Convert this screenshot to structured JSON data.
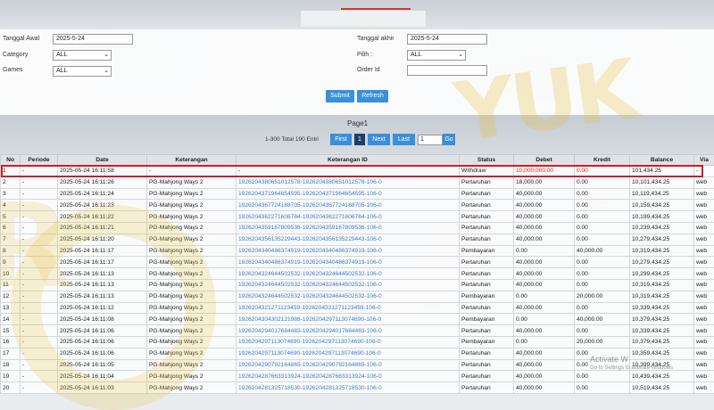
{
  "filters": {
    "tanggal_awal_label": "Tanggal Awal",
    "tanggal_awal_value": "2025-5-24",
    "tanggal_akhir_label": "Tanggal akhir",
    "tanggal_akhir_value": "2025-5-24",
    "category_label": "Category",
    "category_value": "ALL",
    "pilih_label": "Pilih :",
    "pilih_value": "ALL",
    "games_label": "Games",
    "games_value": "ALL",
    "order_id_label": "Order Id",
    "order_id_value": "",
    "submit_label": "Submit",
    "refresh_label": "Refresh"
  },
  "pager": {
    "title": "Page1",
    "total": "1-300 Total 190 Entri",
    "first": "First",
    "current": "1",
    "next": "Next",
    "last": "Last",
    "page_input": "1",
    "go": "Go"
  },
  "table": {
    "headers": [
      "No",
      "Periode",
      "Date",
      "Keterangan",
      "Keterangan ID",
      "Status",
      "Debet",
      "Kredit",
      "Balance",
      "Via"
    ],
    "rows": [
      [
        "1",
        "-",
        "2025-05-24 16:11:58",
        "-",
        "-",
        "Withdraw",
        "10,000,000.00",
        "0.00",
        "101,434.25",
        "-"
      ],
      [
        "2",
        "-",
        "2025-05-24 16:11:26",
        "PG-Mahjong Ways 2",
        "1926204380651012578-1926204380651012578-106-0",
        "Pertaruhan",
        "18,000.00",
        "0.00",
        "10,101,434.25",
        "web"
      ],
      [
        "3",
        "-",
        "2025-05-24 16:11:24",
        "PG-Mahjong Ways 2",
        "1926204371964654595-1926204371964654595-106-0",
        "Pertaruhan",
        "40,000.00",
        "0.00",
        "10,119,434.25",
        "web"
      ],
      [
        "4",
        "-",
        "2025-05-24 16:11:23",
        "PG-Mahjong Ways 2",
        "1926204367724168705-1926204367724168705-106-0",
        "Pertaruhan",
        "40,000.00",
        "0.00",
        "10,159,434.25",
        "web"
      ],
      [
        "5",
        "-",
        "2025-05-24 16:11:22",
        "PG-Mahjong Ways 2",
        "1926204362271606784-1926204362271606784-106-0",
        "Pertaruhan",
        "40,000.00",
        "0.00",
        "10,199,434.25",
        "web"
      ],
      [
        "6",
        "-",
        "2025-05-24 16:11:21",
        "PG-Mahjong Ways 2",
        "1926204359167809536-1926204359167809536-106-0",
        "Pertaruhan",
        "40,000.00",
        "0.00",
        "10,239,434.25",
        "web"
      ],
      [
        "7",
        "-",
        "2025-05-24 16:11:20",
        "PG-Mahjong Ways 2",
        "1926204356135229443-1926204356135229443-106-0",
        "Pertaruhan",
        "40,000.00",
        "0.00",
        "10,279,434.25",
        "web"
      ],
      [
        "8",
        "-",
        "2025-05-24 16:11:17",
        "PG-Mahjong Ways 2",
        "1926204340486374919-1926204340486374919-106-0",
        "Pembayaran",
        "0.00",
        "40,000.00",
        "10,319,434.25",
        "web"
      ],
      [
        "9",
        "-",
        "2025-05-24 16:11:17",
        "PG-Mahjong Ways 2",
        "1926204340486374919-1926204340486374919-106-0",
        "Pertaruhan",
        "40,000.00",
        "0.00",
        "10,279,434.25",
        "web"
      ],
      [
        "10",
        "-",
        "2025-05-24 16:11:13",
        "PG-Mahjong Ways 2",
        "1926204324644502532-1926204324644502532-106-0",
        "Pertaruhan",
        "40,000.00",
        "0.00",
        "10,299,434.25",
        "web"
      ],
      [
        "11",
        "-",
        "2025-05-24 16:11:13",
        "PG-Mahjong Ways 2",
        "1926204324644502532-1926204324644502532-106-0",
        "Pertaruhan",
        "40,000.00",
        "0.00",
        "10,319,434.25",
        "web"
      ],
      [
        "12",
        "-",
        "2025-05-24 16:11:13",
        "PG-Mahjong Ways 2",
        "1926204324644502532-1926204324644502532-106-0",
        "Pembayaran",
        "0.00",
        "20,000.00",
        "10,319,434.25",
        "web"
      ],
      [
        "13",
        "-",
        "2025-05-24 16:11:12",
        "PG-Mahjong Ways 2",
        "1926204321271123459-1926204321271123459-106-0",
        "Pertaruhan",
        "40,000.00",
        "0.00",
        "10,339,434.25",
        "web"
      ],
      [
        "14",
        "-",
        "2025-05-24 16:11:08",
        "PG-Mahjong Ways 2",
        "1926204304302121988-1926204297113074690-106-0",
        "Pembayaran",
        "0.00",
        "40,000.00",
        "10,379,434.25",
        "web"
      ],
      [
        "15",
        "-",
        "2025-05-24 16:11:06",
        "PG-Mahjong Ways 2",
        "1926204294017684483-1926204294017684483-106-0",
        "Pertaruhan",
        "40,000.00",
        "0.00",
        "10,339,434.25",
        "web"
      ],
      [
        "16",
        "-",
        "2025-05-24 16:11:06",
        "PG-Mahjong Ways 2",
        "1926204297113074690-1926204297113074690-106-0",
        "Pembayaran",
        "0.00",
        "20,000.00",
        "10,379,434.25",
        "web"
      ],
      [
        "17",
        "-",
        "2025-05-24 16:11:06",
        "PG-Mahjong Ways 2",
        "1926204297113074690-1926204297113074690-106-0",
        "Pertaruhan",
        "40,000.00",
        "0.00",
        "10,359,434.25",
        "web"
      ],
      [
        "18",
        "-",
        "2025-05-24 16:11:05",
        "PG-Mahjong Ways 2",
        "1926204290792164865-1926204290792164865-106-0",
        "Pertaruhan",
        "40,000.00",
        "0.00",
        "10,399,434.25",
        "web"
      ],
      [
        "19",
        "-",
        "2025-05-24 16:11:04",
        "PG-Mahjong Ways 2",
        "1926204287663313924-1926204287663313924-106-0",
        "Pertaruhan",
        "40,000.00",
        "0.00",
        "10,439,434.25",
        "web"
      ],
      [
        "20",
        "-",
        "2025-05-24 16:11:03",
        "PG-Mahjong Ways 2",
        "1926204281325718530-1926204281325718530-106-0",
        "Pertaruhan",
        "40,000.00",
        "0.00",
        "10,519,434.25",
        "web"
      ]
    ]
  },
  "watermark": {
    "logo_text": "YUK"
  },
  "activation": {
    "line1": "Activate W",
    "line2": "Go to Settings to activate Windows"
  },
  "colors": {
    "accent": "#3a8fd9",
    "highlight": "#c8202a",
    "link": "#3a7dc9"
  }
}
